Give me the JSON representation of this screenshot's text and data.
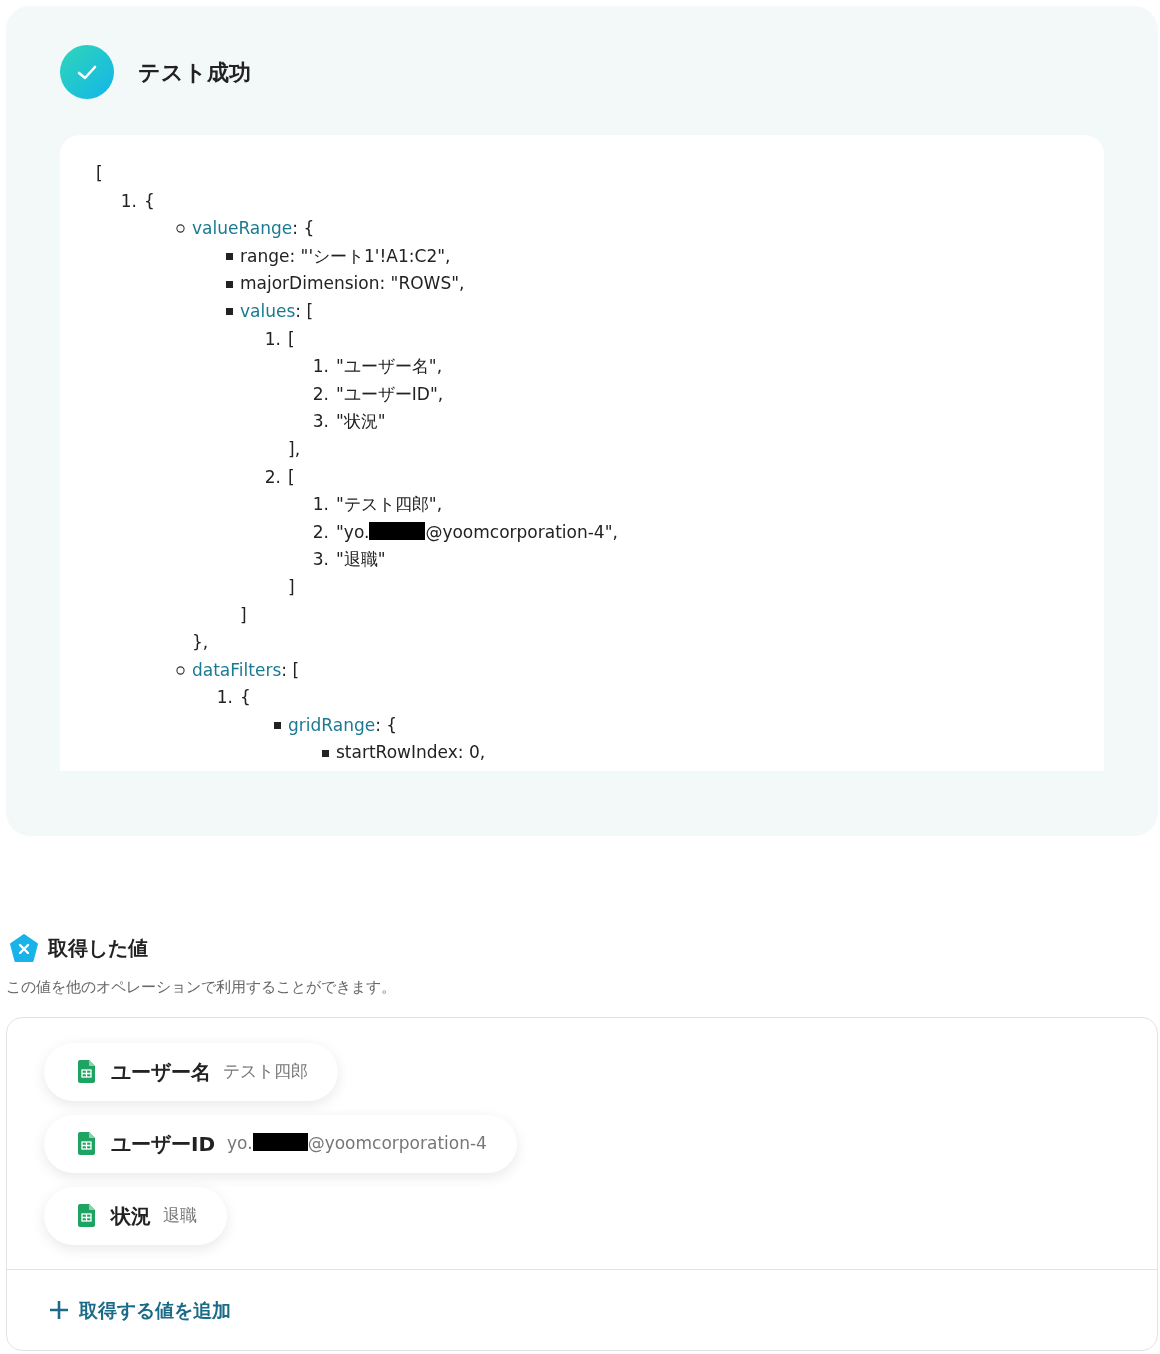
{
  "test_result": {
    "title": "テスト成功",
    "output": {
      "open": "[",
      "items": [
        {
          "marker": "1.",
          "text": "{",
          "children": [
            {
              "kind": "circle",
              "key": "valueRange",
              "text": ": {",
              "close": "},",
              "children": [
                {
                  "kind": "square",
                  "text": "range: \"'シート1'!A1:C2\","
                },
                {
                  "kind": "square",
                  "text": "majorDimension: \"ROWS\","
                },
                {
                  "kind": "square",
                  "key": "values",
                  "text": ": [",
                  "close": "]",
                  "children": [
                    {
                      "marker": "1.",
                      "text": "[",
                      "close": "],",
                      "children": [
                        {
                          "marker": "1.",
                          "text": "\"ユーザー名\","
                        },
                        {
                          "marker": "2.",
                          "text": "\"ユーザーID\","
                        },
                        {
                          "marker": "3.",
                          "text": "\"状況\""
                        }
                      ]
                    },
                    {
                      "marker": "2.",
                      "text": "[",
                      "close": "]",
                      "children": [
                        {
                          "marker": "1.",
                          "text": "\"テスト四郎\","
                        },
                        {
                          "marker": "2.",
                          "parts": [
                            {
                              "kind": "text",
                              "text": "\"yo."
                            },
                            {
                              "kind": "redaction"
                            },
                            {
                              "kind": "text",
                              "text": "@yoomcorporation-4\","
                            }
                          ]
                        },
                        {
                          "marker": "3.",
                          "text": "\"退職\""
                        }
                      ]
                    }
                  ]
                }
              ]
            },
            {
              "kind": "circle",
              "key": "dataFilters",
              "text": ": [",
              "children": [
                {
                  "marker": "1.",
                  "text": "{",
                  "children": [
                    {
                      "kind": "square",
                      "key": "gridRange",
                      "text": ": {",
                      "children": [
                        {
                          "kind": "square",
                          "text": "startRowIndex: 0,"
                        }
                      ]
                    }
                  ]
                }
              ]
            }
          ]
        }
      ]
    }
  },
  "obtained_values": {
    "title": "取得した値",
    "description": "この値を他のオペレーションで利用することができます。",
    "values": [
      {
        "label": "ユーザー名",
        "value": [
          {
            "kind": "text",
            "text": "テスト四郎"
          }
        ]
      },
      {
        "label": "ユーザーID",
        "value": [
          {
            "kind": "text",
            "text": "yo."
          },
          {
            "kind": "redaction"
          },
          {
            "kind": "text",
            "text": "@yoomcorporation-4"
          }
        ]
      },
      {
        "label": "状況",
        "value": [
          {
            "kind": "text",
            "text": "退職"
          }
        ]
      }
    ],
    "add_button": {
      "label": "取得する値を追加"
    }
  }
}
